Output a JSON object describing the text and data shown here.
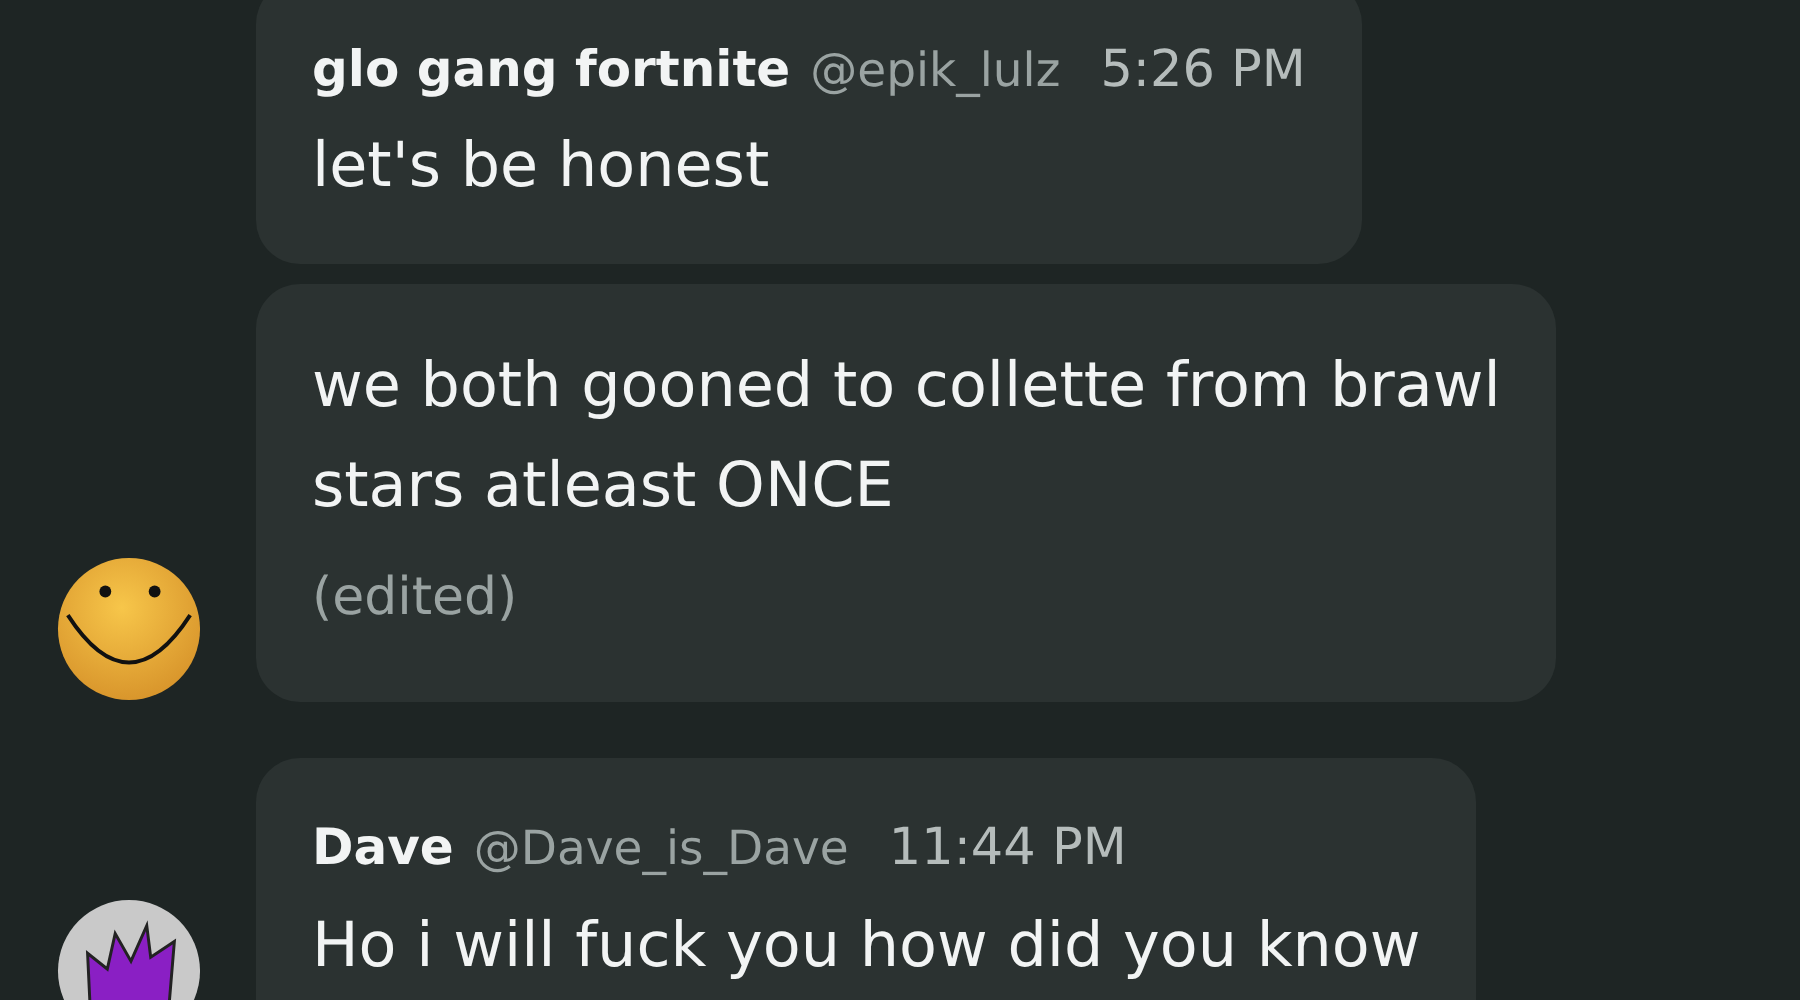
{
  "messages": [
    {
      "author": "glo gang fortnite",
      "handle": "@epik_lulz",
      "time": "5:26 PM",
      "lines": [
        "let's be honest"
      ]
    },
    {
      "lines": [
        "we both gooned to collette from brawl",
        "stars atleast ONCE"
      ],
      "note": "(edited)",
      "avatar": {
        "kind": "smiley"
      }
    },
    {
      "author": "Dave",
      "handle": "@Dave_is_Dave",
      "time": "11:44 PM",
      "lines": [
        "Ho i will fuck you how did you know"
      ],
      "avatar": {
        "kind": "spiky"
      }
    }
  ]
}
